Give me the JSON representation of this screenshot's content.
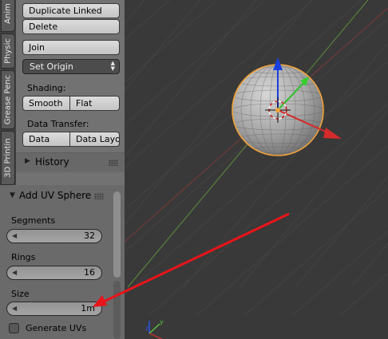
{
  "tabs": [
    {
      "label": "Anim"
    },
    {
      "label": "Physic"
    },
    {
      "label": "Grease Penc"
    },
    {
      "label": "3D Printin"
    }
  ],
  "toolshelf": {
    "duplicate_linked": "Duplicate Linked",
    "delete": "Delete",
    "join": "Join",
    "set_origin": "Set Origin",
    "shading_label": "Shading:",
    "smooth": "Smooth",
    "flat": "Flat",
    "data_transfer_label": "Data Transfer:",
    "data": "Data",
    "data_layout": "Data Layo",
    "history": "History"
  },
  "operator": {
    "title": "Add UV Sphere",
    "segments_label": "Segments",
    "segments": "32",
    "rings_label": "Rings",
    "rings": "16",
    "size_label": "Size",
    "size": "1m",
    "generate_uvs": "Generate UVs",
    "generate_uvs_checked": false
  },
  "viewport": {
    "object": "uv-sphere",
    "selection_outline_color": "#f2a33a",
    "x_axis_color": "#b33636",
    "y_axis_color": "#6aa43a",
    "annotation_arrow_color": "#e8141a"
  }
}
